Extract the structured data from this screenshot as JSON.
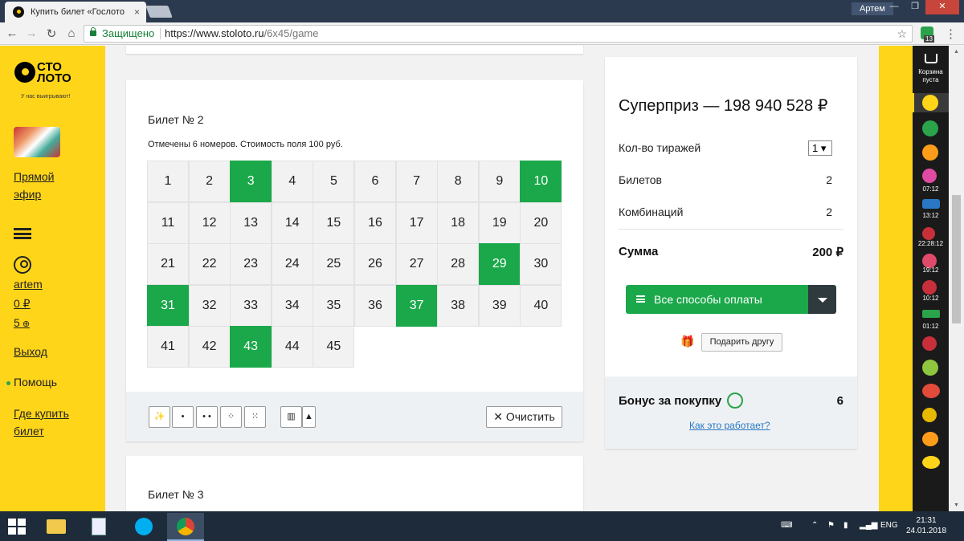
{
  "browser": {
    "tab_title": "Купить билет «Гослото",
    "tab_close": "×",
    "user": "Артем",
    "win_min": "—",
    "win_restore": "❐",
    "win_close": "✕",
    "back": "←",
    "forward": "→",
    "reload": "↻",
    "home": "⌂",
    "secure_label": "Защищено",
    "url_main": "https://www.stoloto.ru",
    "url_path": "/6x45/game",
    "star": "☆",
    "ext_badge": "13",
    "menu": "⋮"
  },
  "leftbar": {
    "logo_line1": "СТО",
    "logo_line2": "ЛОТО",
    "logo_sub": "У нас выигрывают!",
    "live_1": "Прямой",
    "live_2": "эфир",
    "username": "artem",
    "balance": "0 ₽",
    "bonus": "5",
    "logout": "Выход",
    "help": "Помощь",
    "where_1": "Где купить",
    "where_2": "билет"
  },
  "ticket": {
    "title": "Билет № 2",
    "note": "Отмечены 6 номеров. Стоимость поля 100 руб.",
    "numbers": [
      1,
      2,
      3,
      4,
      5,
      6,
      7,
      8,
      9,
      10,
      11,
      12,
      13,
      14,
      15,
      16,
      17,
      18,
      19,
      20,
      21,
      22,
      23,
      24,
      25,
      26,
      27,
      28,
      29,
      30,
      31,
      32,
      33,
      34,
      35,
      36,
      37,
      38,
      39,
      40,
      41,
      42,
      43,
      44,
      45
    ],
    "selected": [
      3,
      10,
      29,
      31,
      37,
      43
    ],
    "tools": [
      "✨",
      "•",
      "• •",
      "⁘",
      "⁙",
      "▥",
      "▲"
    ],
    "clear_label": "✕ Очистить",
    "selected_color": "#1ba84a"
  },
  "next_ticket": {
    "title": "Билет № 3"
  },
  "summary": {
    "prize": "Суперприз —  198 940 528 ₽",
    "draws_label": "Кол-во тиражей",
    "draws_value": "1 ▾",
    "tickets_label": "Билетов",
    "tickets_value": "2",
    "combos_label": "Комбинаций",
    "combos_value": "2",
    "total_label": "Сумма",
    "total_value": "200 ₽",
    "pay_label": "Все способы оплаты",
    "gift_label": "Подарить другу",
    "gift_icon": "🎁",
    "bonus_label": "Бонус за покупку",
    "bonus_value": "6",
    "how_link": "Как это работает?",
    "accent": "#1ba84a"
  },
  "gamebar": {
    "cart_1": "Корзина",
    "cart_2": "пуста",
    "times": [
      "07:12",
      "13:12",
      "22:28:12",
      "19:12",
      "10:12",
      "01:12"
    ]
  },
  "taskbar": {
    "lang": "ENG",
    "time": "21:31",
    "date": "24.01.2018"
  }
}
